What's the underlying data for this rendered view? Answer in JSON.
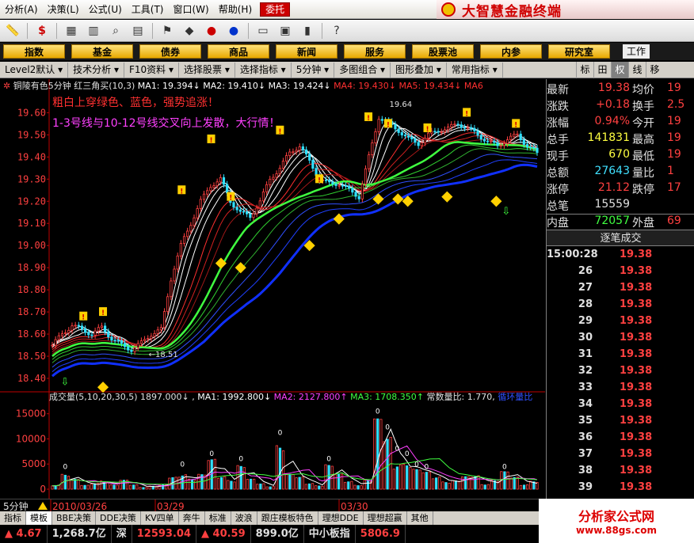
{
  "menubar": {
    "items": [
      "分析(A)",
      "决策(L)",
      "公式(U)",
      "工具(T)",
      "窗口(W)",
      "帮助(H)",
      "委托"
    ]
  },
  "brand": {
    "name": "大智慧金融终端"
  },
  "navbar": {
    "items": [
      "指数",
      "基金",
      "债券",
      "商品",
      "新闻",
      "服务",
      "股票池",
      "内参",
      "研究室"
    ],
    "right": "工作"
  },
  "subbar": {
    "items": [
      "Level2默认",
      "技术分析",
      "F10资料",
      "选择股票",
      "选择指标",
      "5分钟",
      "多图组合",
      "图形叠加",
      "常用指标"
    ],
    "right_tabs": [
      "标",
      "田",
      "权",
      "线",
      "移"
    ]
  },
  "chart": {
    "title": "铜陵有色5分钟",
    "indicator": "红三角买(10,3)",
    "ma": [
      {
        "label": "MA1: 19.394↓",
        "color": "#ffffff"
      },
      {
        "label": "MA2: 19.410↓",
        "color": "#ffffff"
      },
      {
        "label": "MA3: 19.424↓",
        "color": "#ffffff"
      },
      {
        "label": "MA4: 19.430↓",
        "color": "#ff3030"
      },
      {
        "label": "MA5: 19.434↓",
        "color": "#ff3030"
      },
      {
        "label": "MA6",
        "color": "#ff3030"
      }
    ],
    "note1": "粗白上穿绿色、蓝色，强势追涨！",
    "note2": "1-3号线与10-12号线交叉向上发散，大行情！",
    "high_label": "19.64",
    "low_label": "18.51",
    "yticks": [
      "19.60",
      "19.50",
      "19.40",
      "19.30",
      "19.20",
      "19.10",
      "19.00",
      "18.90",
      "18.80",
      "18.70",
      "18.60",
      "18.50",
      "18.40"
    ],
    "vol_header": "成交量(5,10,20,30,5) 1897.000↓",
    "vol_ma": [
      {
        "label": "MA1: 1992.800↓",
        "color": "#ffffff"
      },
      {
        "label": "MA2: 2127.800↑",
        "color": "#ff40ff"
      },
      {
        "label": "MA3: 1708.350↑",
        "color": "#40ff40"
      },
      {
        "label": "常数量比: 1.770,",
        "color": "#e0e0e0"
      },
      {
        "label": "循环量比",
        "color": "#3050ff"
      }
    ],
    "vol_yticks": [
      "15000",
      "10000",
      "5000",
      "0"
    ],
    "period": "5分钟",
    "dates": [
      "2010/03/26",
      "03/29",
      "03/30"
    ]
  },
  "chart_data": {
    "type": "candlestick",
    "title": "铜陵有色5分钟",
    "ylim": [
      18.35,
      19.68
    ],
    "price_path": [
      18.55,
      18.6,
      18.64,
      18.62,
      18.6,
      18.63,
      18.58,
      18.55,
      18.53,
      18.56,
      18.6,
      18.62,
      18.85,
      19.0,
      19.1,
      19.2,
      19.27,
      19.3,
      19.2,
      19.15,
      19.13,
      19.2,
      19.3,
      19.35,
      19.42,
      19.45,
      19.38,
      19.3,
      19.28,
      19.28,
      19.25,
      19.22,
      19.4,
      19.58,
      19.55,
      19.52,
      19.48,
      19.46,
      19.5,
      19.52,
      19.53,
      19.55,
      19.53,
      19.5,
      19.47,
      19.45,
      19.48,
      19.5,
      19.45,
      19.42
    ],
    "vol_ylim": [
      0,
      17000
    ],
    "volumes": [
      1200,
      3500,
      2000,
      800,
      1500,
      2200,
      900,
      1800,
      1000,
      600,
      700,
      900,
      2500,
      4000,
      2500,
      3000,
      6000,
      3000,
      2500,
      5000,
      2000,
      1200,
      800,
      10000,
      3000,
      2500,
      1500,
      900,
      5000,
      3000,
      1800,
      1200,
      2000,
      14000,
      11000,
      7000,
      6000,
      4000,
      3500,
      3000,
      2000,
      1800,
      2500,
      3000,
      1500,
      2000,
      3500,
      2500,
      1200,
      2000
    ]
  },
  "quote": {
    "rows": [
      {
        "k": "最新",
        "v": "19.38",
        "vc": "#ff4040",
        "k2": "均价",
        "v2": "19"
      },
      {
        "k": "涨跌",
        "v": "+0.18",
        "vc": "#ff4040",
        "k2": "换手",
        "v2": "2.5"
      },
      {
        "k": "涨幅",
        "v": "0.94%",
        "vc": "#ff4040",
        "k2": "今开",
        "v2": "19"
      },
      {
        "k": "总手",
        "v": "141831",
        "vc": "#ffff40",
        "k2": "最高",
        "v2": "19"
      },
      {
        "k": "现手",
        "v": "670",
        "vc": "#ffff40",
        "k2": "最低",
        "v2": "19"
      },
      {
        "k": "总额",
        "v": "27643",
        "vc": "#40e0ff",
        "k2": "量比",
        "v2": "1"
      },
      {
        "k": "涨停",
        "v": "21.12",
        "vc": "#ff4040",
        "k2": "跌停",
        "v2": "17"
      },
      {
        "k": "总笔",
        "v": "15559",
        "vc": "#e0e0e0",
        "k2": "",
        "v2": ""
      },
      {
        "k": "内盘",
        "v": "72057",
        "vc": "#40ff40",
        "k2": "外盘",
        "v2": "69"
      }
    ],
    "ticks_title": "逐笔成交",
    "ticks": [
      {
        "t": "15:00:28",
        "p": "19.38"
      },
      {
        "t": "26",
        "p": "19.38"
      },
      {
        "t": "27",
        "p": "19.38"
      },
      {
        "t": "28",
        "p": "19.38"
      },
      {
        "t": "29",
        "p": "19.38"
      },
      {
        "t": "30",
        "p": "19.38"
      },
      {
        "t": "31",
        "p": "19.38"
      },
      {
        "t": "32",
        "p": "19.38"
      },
      {
        "t": "33",
        "p": "19.38"
      },
      {
        "t": "34",
        "p": "19.38"
      },
      {
        "t": "35",
        "p": "19.38"
      },
      {
        "t": "36",
        "p": "19.38"
      },
      {
        "t": "37",
        "p": "19.38"
      },
      {
        "t": "38",
        "p": "19.38"
      },
      {
        "t": "39",
        "p": "19.38"
      }
    ]
  },
  "tabs": {
    "items": [
      "指标",
      "模板",
      "BBE决策",
      "DDE决策",
      "KV四单",
      "奔牛",
      "标准",
      "波浪",
      "跟庄模板特色",
      "理想DDE",
      "理想超赢",
      "其他"
    ],
    "active": 1
  },
  "ticker": [
    {
      "text": "▲ 4.67",
      "color": "#ff4040"
    },
    {
      "text": "1,268.7亿",
      "color": "#e0e0e0"
    },
    {
      "text": "深",
      "color": "#e0e0e0"
    },
    {
      "text": "12593.04",
      "color": "#ff4040"
    },
    {
      "text": "▲ 40.59",
      "color": "#ff4040"
    },
    {
      "text": "899.0亿",
      "color": "#e0e0e0"
    },
    {
      "text": "中小板指",
      "color": "#e0e0e0"
    },
    {
      "text": "5806.9",
      "color": "#ff4040"
    }
  ],
  "watermark": {
    "name": "分析家公式网",
    "url": "www.88gs.com"
  }
}
